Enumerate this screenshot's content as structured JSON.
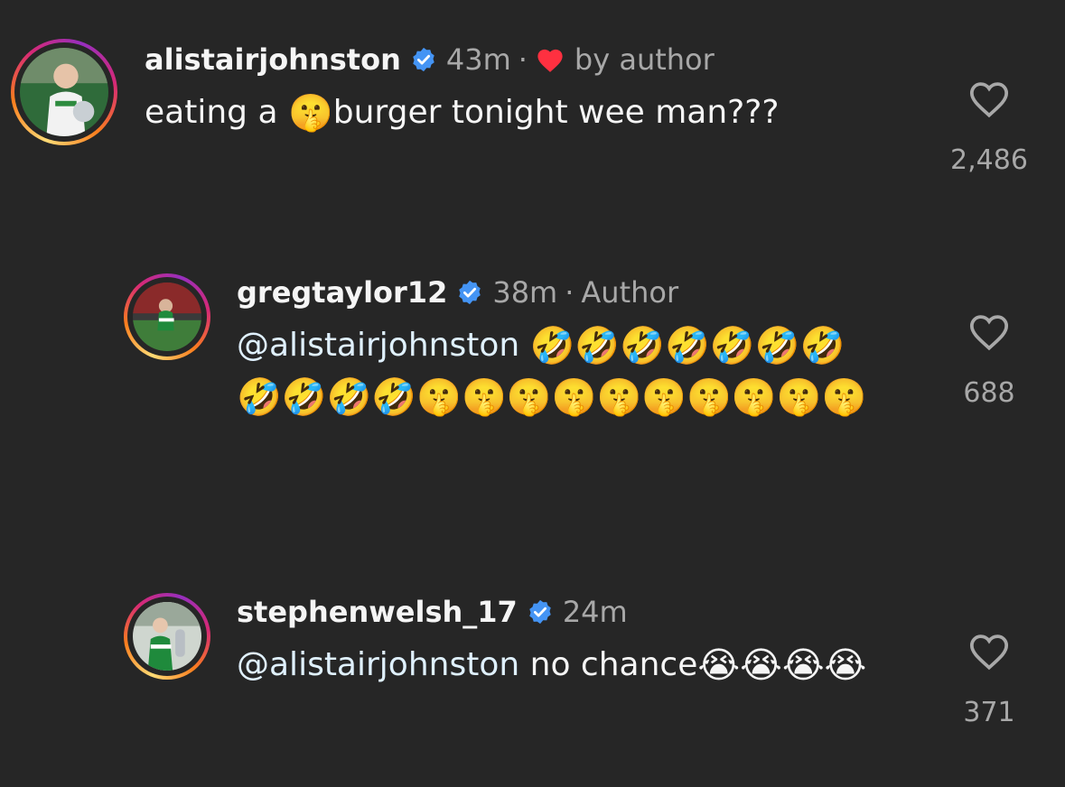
{
  "comments": [
    {
      "username": "alistairjohnston",
      "time": "43m",
      "liked_by_author": "by author",
      "text_before": "eating a",
      "emoji_before": "🤫",
      "text_after": "burger tonight wee man???",
      "likes": "2,486"
    },
    {
      "username": "gregtaylor12",
      "time": "38m",
      "tag": "Author",
      "mention": "@alistairjohnston",
      "emojis": "🤣🤣🤣🤣🤣🤣🤣🤣🤣🤣🤣🤫🤫🤫🤫🤫🤫🤫🤫🤫🤫",
      "likes": "688"
    },
    {
      "username": "stephenwelsh_17",
      "time": "24m",
      "mention": "@alistairjohnston",
      "text": "no chance",
      "emojis": "😭😭😭😭",
      "likes": "371"
    }
  ],
  "icons": {
    "verified": "verified-badge-icon",
    "like": "heart-outline-icon",
    "author_like": "heart-filled-red-icon"
  },
  "colors": {
    "background": "#262626",
    "verified": "#4494f4",
    "heart": "#ff3040",
    "muted": "#a8a8a8"
  }
}
